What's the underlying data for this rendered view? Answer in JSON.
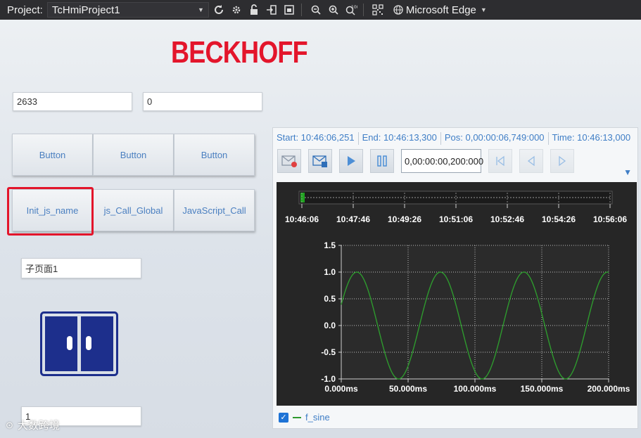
{
  "toolbar": {
    "project_label": "Project:",
    "project_value": "TcHmiProject1",
    "browser_label": "Microsoft Edge"
  },
  "logo": "BECKHOFF",
  "textboxes": {
    "value_a": "2633",
    "value_b": "0",
    "subpage": "子页面1",
    "bottom": "1"
  },
  "buttons_row1": [
    "Button",
    "Button",
    "Button"
  ],
  "buttons_row2": [
    "Init_js_name",
    "js_Call_Global",
    "JavaScript_Call"
  ],
  "trend": {
    "start": "Start: 10:46:06,251",
    "end": "End: 10:46:13,300",
    "pos": "Pos: 0,00:00:06,749:000",
    "time": "Time: 10:46:13,000",
    "interval": "0,00:00:00,200:000",
    "legend": "f_sine",
    "overview_ticks": [
      "10:46:06",
      "10:47:46",
      "10:49:26",
      "10:51:06",
      "10:52:46",
      "10:54:26",
      "10:56:06"
    ]
  },
  "chart_data": {
    "type": "line",
    "xlim": [
      0,
      200
    ],
    "ylim": [
      -1.0,
      1.5
    ],
    "xticks": [
      "0.000ms",
      "50.000ms",
      "100.000ms",
      "150.000ms",
      "200.000ms"
    ],
    "yticks": [
      "1.5",
      "1.0",
      "0.5",
      "0.0",
      "-0.5",
      "-1.0"
    ],
    "grid": true,
    "series": [
      {
        "name": "f_sine",
        "color": "#2e9a2e",
        "period_ms": 62.5,
        "phase_ms": 4,
        "amplitude": 1.0
      }
    ]
  },
  "watermark": "大数跨境",
  "colors": {
    "accent": "#3f7ec6",
    "brand": "#e3152b",
    "toolbar": "#2d2d30"
  }
}
